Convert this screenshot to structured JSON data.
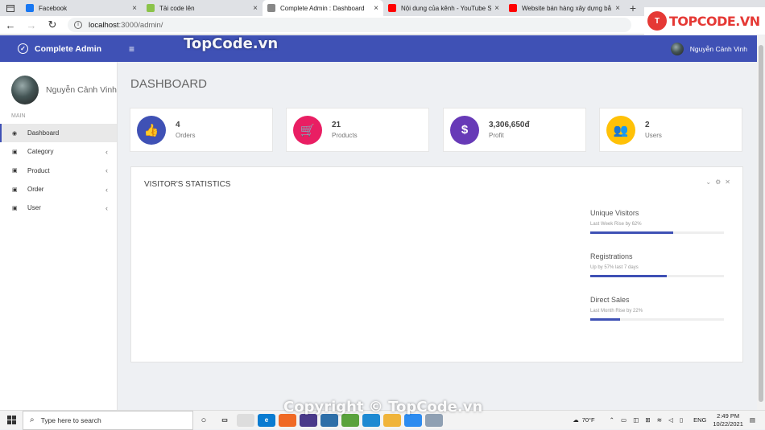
{
  "browser": {
    "tabs": [
      {
        "title": "Facebook",
        "icon": "facebook-icon",
        "color": "#1877f2",
        "active": false
      },
      {
        "title": "Tải code lên",
        "icon": "topcode-icon",
        "color": "#8bc34a",
        "active": false
      },
      {
        "title": "Complete Admin : Dashboard",
        "icon": "page-icon",
        "color": "#888888",
        "active": true
      },
      {
        "title": "Nội dung của kênh - YouTube St",
        "icon": "youtube-icon",
        "color": "#ff0000",
        "active": false
      },
      {
        "title": "Website bán hàng xây dựng bằ",
        "icon": "youtube-icon",
        "color": "#ff0000",
        "active": false
      }
    ],
    "new_tab": "+",
    "url_host": "localhost",
    "url_path": ":3000/admin/"
  },
  "watermark": {
    "top": "TopCode.vn",
    "bottom": "Copyright © TopCode.vn",
    "logo_badge": "T",
    "logo_text": "TOPCODE.VN"
  },
  "header": {
    "brand": "Complete Admin",
    "menu_toggle": "≡",
    "user_name": "Nguyễn Cảnh Vinh"
  },
  "sidebar": {
    "profile_name": "Nguyễn Cảnh Vinh",
    "section": "MAIN",
    "items": [
      {
        "label": "Dashboard",
        "icon": "dashboard-icon",
        "active": true,
        "arrow": ""
      },
      {
        "label": "Category",
        "icon": "suitcase-icon",
        "active": false,
        "arrow": "‹"
      },
      {
        "label": "Product",
        "icon": "suitcase-icon",
        "active": false,
        "arrow": "‹"
      },
      {
        "label": "Order",
        "icon": "suitcase-icon",
        "active": false,
        "arrow": "‹"
      },
      {
        "label": "User",
        "icon": "suitcase-icon",
        "active": false,
        "arrow": "‹"
      }
    ]
  },
  "main": {
    "title": "DASHBOARD",
    "cards": [
      {
        "value": "4",
        "label": "Orders",
        "icon": "thumbs-up-icon",
        "glyph": "👍",
        "color": "#3f51b5"
      },
      {
        "value": "21",
        "label": "Products",
        "icon": "cart-icon",
        "glyph": "🛒",
        "color": "#e91e63"
      },
      {
        "value": "3,306,650đ",
        "label": "Profit",
        "icon": "dollar-icon",
        "glyph": "$",
        "color": "#673ab7"
      },
      {
        "value": "2",
        "label": "Users",
        "icon": "users-icon",
        "glyph": "👥",
        "color": "#ffc107"
      }
    ],
    "panel": {
      "title": "VISITOR'S STATISTICS",
      "tools": "⌄⚙✕",
      "stats": [
        {
          "name": "Unique Visitors",
          "desc": "Last Week Rise by 62%",
          "progress": 0.62
        },
        {
          "name": "Registrations",
          "desc": "Up by 57% last 7 days",
          "progress": 0.57
        },
        {
          "name": "Direct Sales",
          "desc": "Last Month Rise by 22%",
          "progress": 0.22
        }
      ]
    }
  },
  "taskbar": {
    "search_placeholder": "Type here to search",
    "weather": "70°F",
    "lang": "ENG",
    "time": "2:49 PM",
    "date": "10/22/2021"
  }
}
